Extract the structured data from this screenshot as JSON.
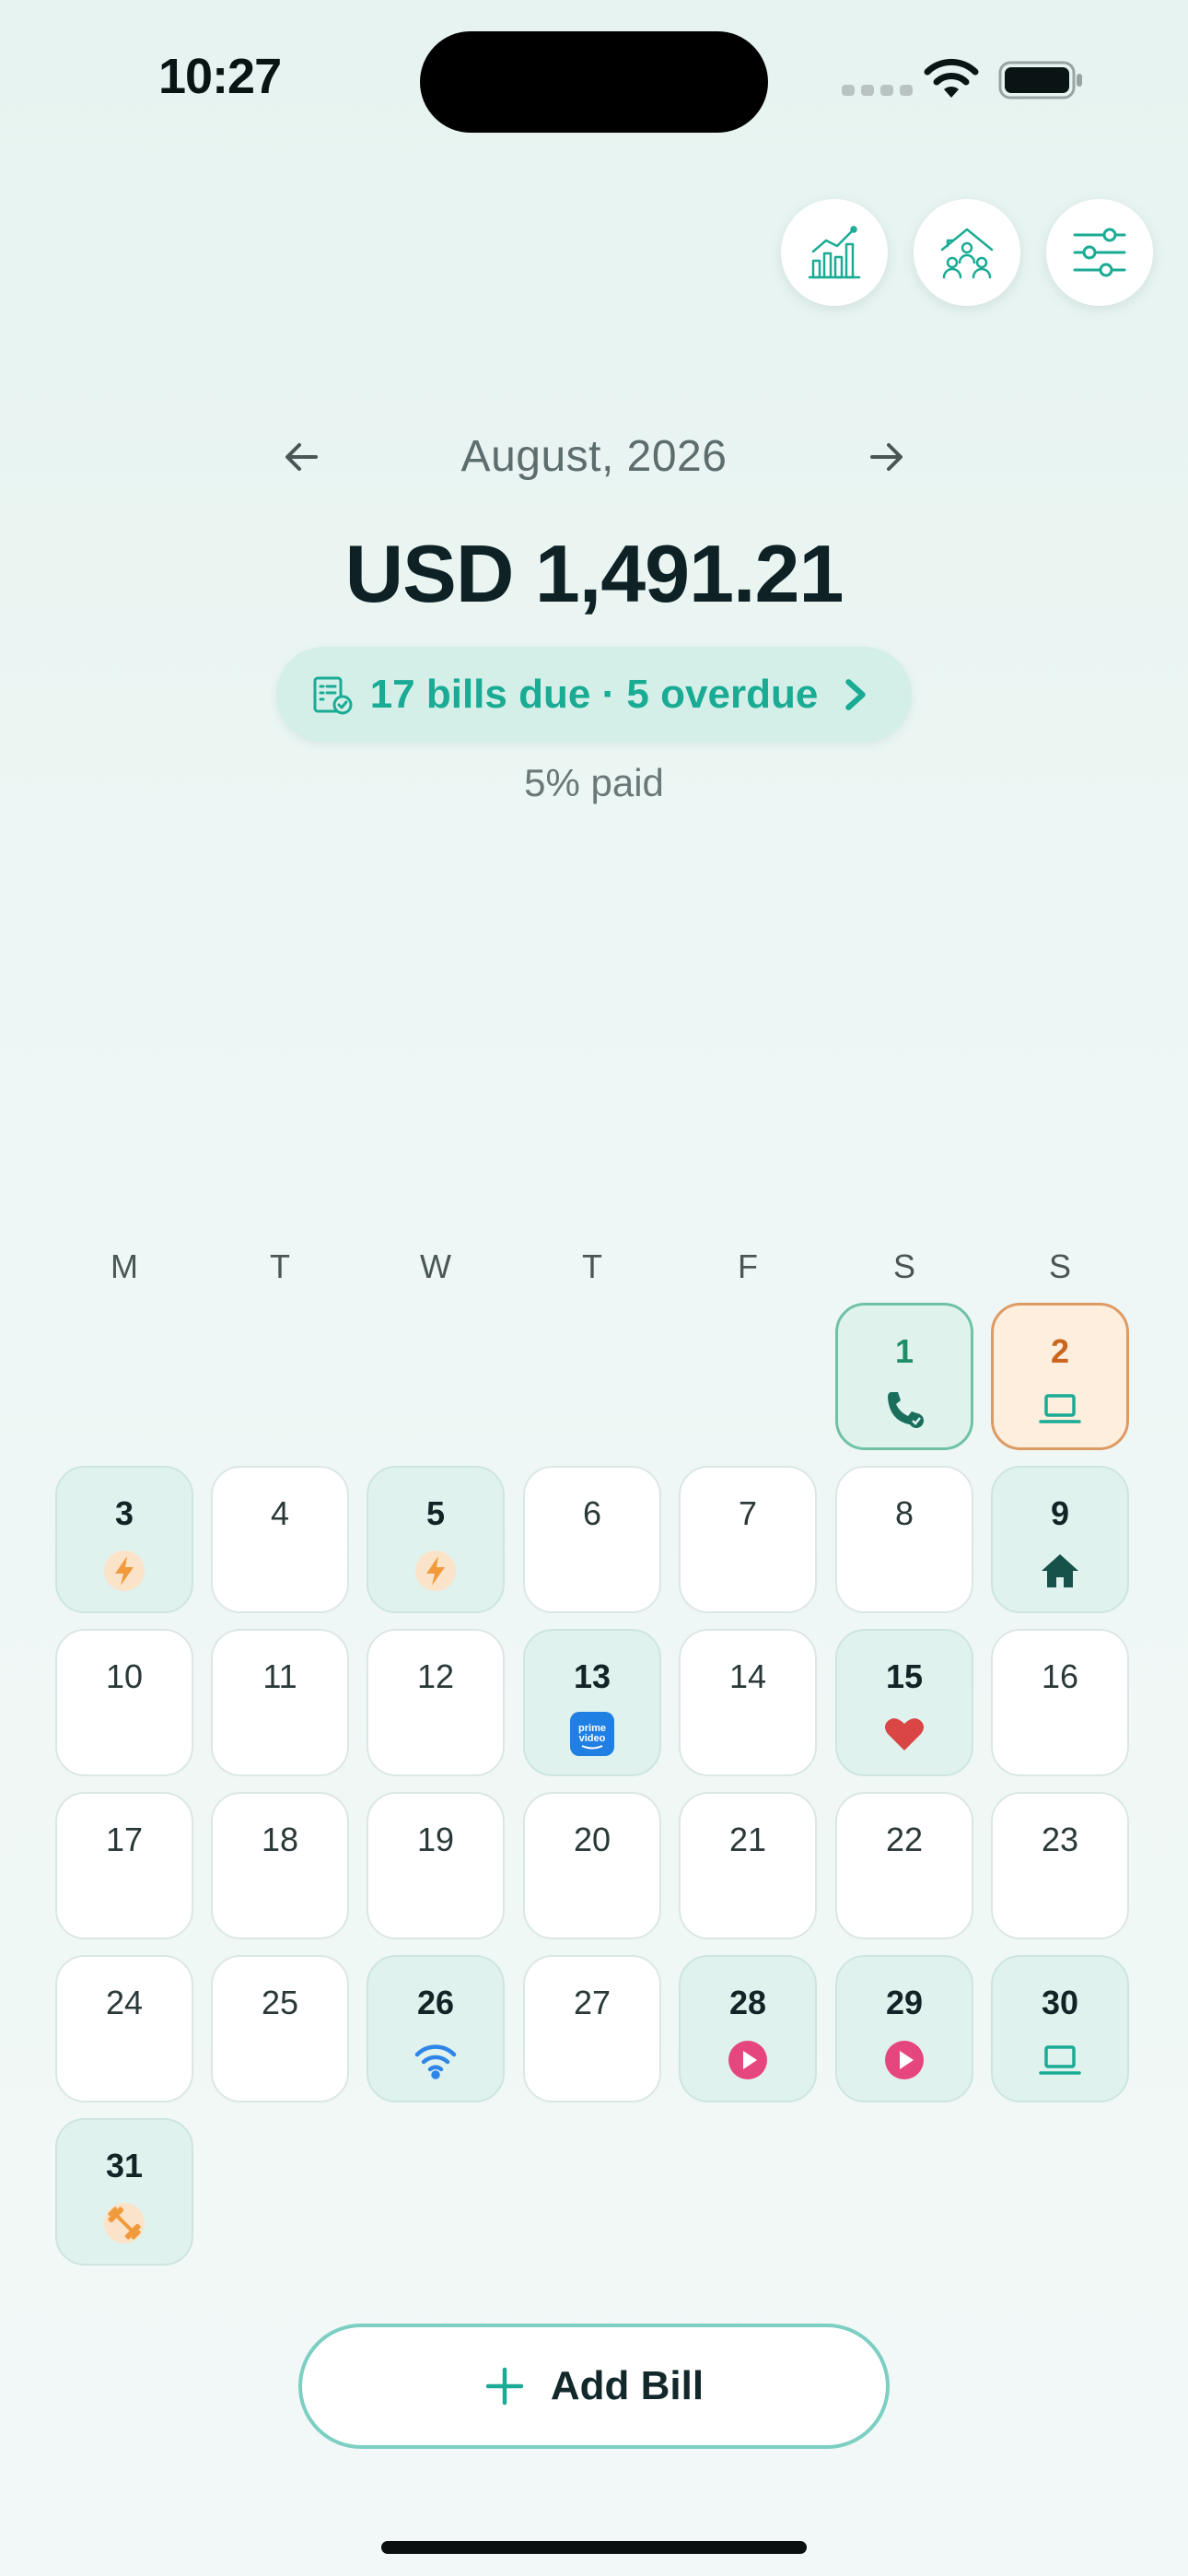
{
  "status_bar": {
    "time": "10:27"
  },
  "header_buttons": [
    {
      "name": "insights-button",
      "icon": "bar-chart-icon"
    },
    {
      "name": "household-button",
      "icon": "household-icon"
    },
    {
      "name": "filters-button",
      "icon": "sliders-icon"
    }
  ],
  "month": {
    "label": "August, 2026",
    "prev_icon": "arrow-left-icon",
    "next_icon": "arrow-right-icon"
  },
  "summary": {
    "total": "USD 1,491.21",
    "bills_summary": "17 bills due · 5 overdue",
    "paid_label": "5% paid"
  },
  "calendar": {
    "weekdays": [
      "M",
      "T",
      "W",
      "T",
      "F",
      "S",
      "S"
    ],
    "days": [
      {
        "num": "1",
        "icon": "phone-icon"
      },
      {
        "num": "2",
        "icon": "laptop-icon"
      },
      {
        "num": "3",
        "icon": "lightning-icon"
      },
      {
        "num": "4"
      },
      {
        "num": "5",
        "icon": "lightning-icon"
      },
      {
        "num": "6"
      },
      {
        "num": "7"
      },
      {
        "num": "8"
      },
      {
        "num": "9",
        "icon": "home-icon"
      },
      {
        "num": "10"
      },
      {
        "num": "11"
      },
      {
        "num": "12"
      },
      {
        "num": "13",
        "icon": "prime-video-icon",
        "icon_text": "prime video"
      },
      {
        "num": "14"
      },
      {
        "num": "15",
        "icon": "heart-icon"
      },
      {
        "num": "16"
      },
      {
        "num": "17"
      },
      {
        "num": "18"
      },
      {
        "num": "19"
      },
      {
        "num": "20"
      },
      {
        "num": "21"
      },
      {
        "num": "22"
      },
      {
        "num": "23"
      },
      {
        "num": "24"
      },
      {
        "num": "25"
      },
      {
        "num": "26",
        "icon": "wifi-icon"
      },
      {
        "num": "27"
      },
      {
        "num": "28",
        "icon": "play-icon"
      },
      {
        "num": "29",
        "icon": "play-icon"
      },
      {
        "num": "30",
        "icon": "laptop-icon"
      },
      {
        "num": "31",
        "icon": "dumbbell-icon"
      }
    ]
  },
  "actions": {
    "add_bill": "Add Bill"
  },
  "colors": {
    "accent": "#1aab95",
    "overdue_orange": "#de9a63",
    "selected_green": "#6fc2a4",
    "text_dark": "#12282a"
  }
}
